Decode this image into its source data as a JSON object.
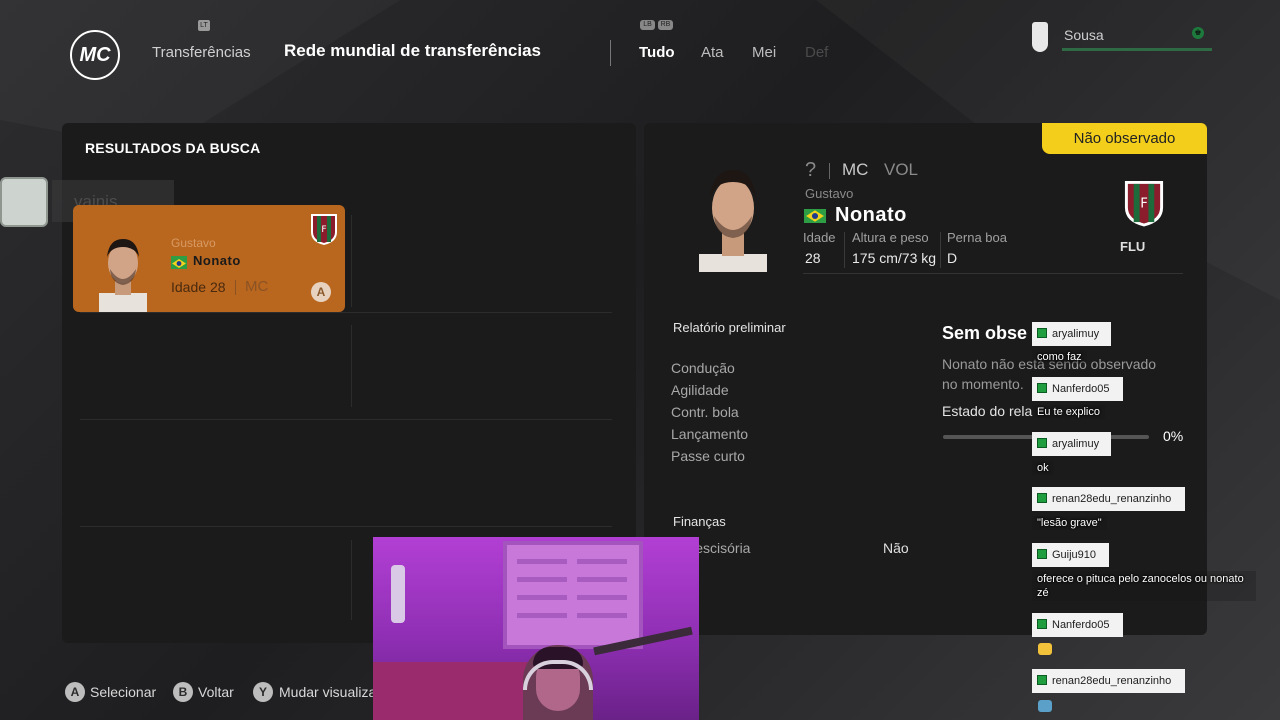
{
  "header": {
    "logo_text": "MC",
    "prev_section": "Transferências",
    "title": "Rede mundial de transferências",
    "lt_button": "LT",
    "lb_button": "LB",
    "rb_button": "RB",
    "tabs": [
      {
        "label": "Tudo",
        "state": "active"
      },
      {
        "label": "Ata",
        "state": "normal"
      },
      {
        "label": "Mei",
        "state": "normal"
      },
      {
        "label": "Def",
        "state": "disabled"
      }
    ],
    "user_name": "Sousa"
  },
  "search": {
    "title": "RESULTADOS DA BUSCA",
    "ghost_text": "vainis"
  },
  "player_card": {
    "first_name": "Gustavo",
    "last_name": "Nonato",
    "age_label": "Idade",
    "age": "28",
    "position": "MC",
    "select_button": "A",
    "nationality_flag": "brazil-flag"
  },
  "detail": {
    "scout_badge": "Não observado",
    "overall": "?",
    "position_primary": "MC",
    "position_secondary": "VOL",
    "first_name": "Gustavo",
    "last_name": "Nonato",
    "age_label": "Idade",
    "age": "28",
    "height_weight_label": "Altura e peso",
    "height_weight": "175 cm/73 kg",
    "foot_label": "Perna boa",
    "foot": "D",
    "club": "FLU",
    "report_title": "Relatório preliminar",
    "attributes": [
      "Condução",
      "Agilidade",
      "Contr. bola",
      "Lançamento",
      "Passe curto"
    ],
    "obs_title": "Sem obse",
    "obs_text_1": "Nonato não está sendo observado",
    "obs_text_2": "no momento.",
    "status_label": "Estado do rela",
    "progress": 0,
    "progress_text": "0%",
    "finance_title": "Finanças",
    "finance_label": "ta rescisória",
    "finance_value": "Não"
  },
  "controls": [
    {
      "button": "A",
      "label": "Selecionar"
    },
    {
      "button": "B",
      "label": "Voltar"
    },
    {
      "button": "Y",
      "label": "Mudar visualiza"
    }
  ],
  "chat": [
    {
      "user": "aryalimuy",
      "message": "como faz"
    },
    {
      "user": "Nanferdo05",
      "message": "Eu te explico"
    },
    {
      "user": "aryalimuy",
      "message": "ok"
    },
    {
      "user": "renan28edu_renanzinho",
      "message": "\"lesão grave\""
    },
    {
      "user": "Guiju910",
      "message": "oferece o pituca pelo zanocelos ou nonato zé"
    },
    {
      "user": "Nanferdo05",
      "message": ""
    },
    {
      "user": "renan28edu_renanzinho",
      "message": ""
    }
  ],
  "colors": {
    "card_orange": "#b9661f",
    "badge_yellow": "#f3cf1c",
    "panel": "#1b1b1c",
    "chat_green": "#1f9d3f"
  }
}
